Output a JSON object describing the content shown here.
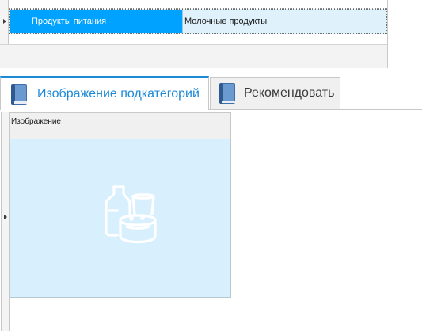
{
  "top_grid": {
    "selected_row": {
      "category": "Продукты питания",
      "subcategory": "Молочные продукты"
    }
  },
  "tabs": [
    {
      "label": "Изображение подкатегорий",
      "active": true,
      "icon": "book-icon"
    },
    {
      "label": "Рекомендовать",
      "active": false,
      "icon": "book-icon"
    }
  ],
  "image_grid": {
    "column_header": "Изображение",
    "image_icon": "dairy-products-icon"
  },
  "colors": {
    "selection_blue": "#00a2ff",
    "row_highlight": "#dff1fb",
    "tab_accent": "#1d8ad8",
    "image_bg": "#d8f0fd"
  }
}
